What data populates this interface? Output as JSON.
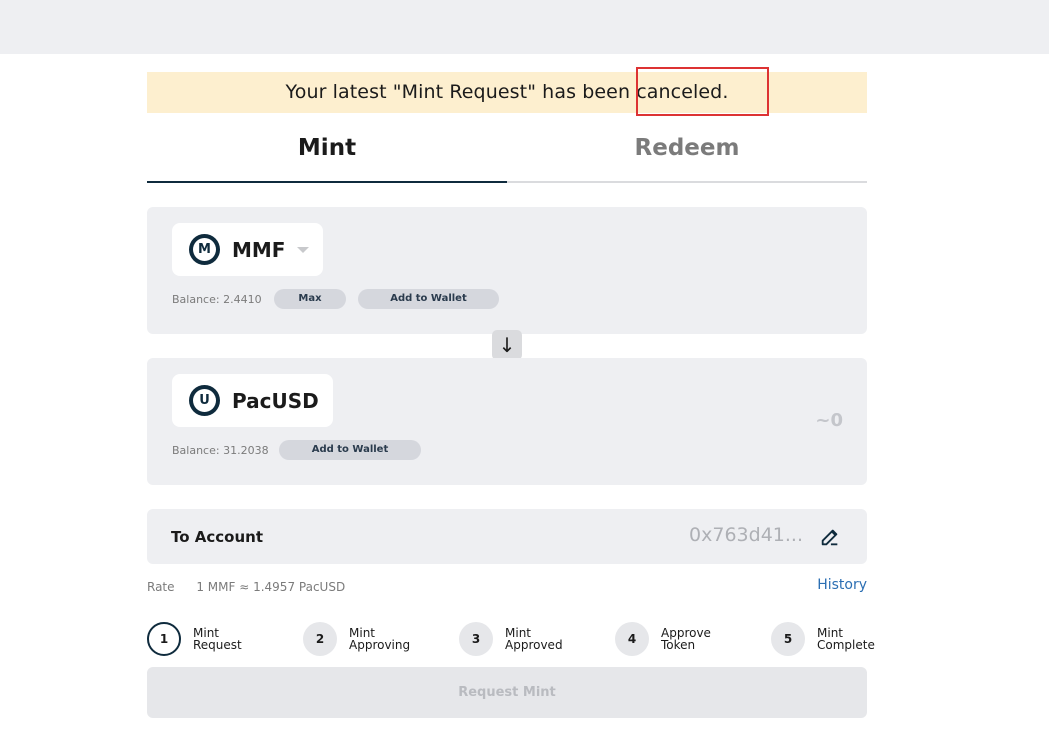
{
  "notice": {
    "text": "Your latest \"Mint Request\" has been canceled."
  },
  "tabs": [
    {
      "label": "Mint",
      "active": true
    },
    {
      "label": "Redeem",
      "active": false
    }
  ],
  "from": {
    "token": "MMF",
    "icon": "mmf-token-icon",
    "balance": "Balance: 2.4410",
    "max_label": "Max",
    "add_wallet_label": "Add to Wallet"
  },
  "swap_arrow": "↓",
  "to": {
    "token": "PacUSD",
    "icon": "pacusd-token-icon",
    "balance": "Balance: 31.2038",
    "add_wallet_label": "Add to Wallet",
    "amount": "~0"
  },
  "account": {
    "label": "To Account",
    "address": "0x763d41...",
    "edit_icon": "pencil-edit-icon"
  },
  "rate": {
    "label": "Rate",
    "value": "1 MMF ≈ 1.4957 PacUSD"
  },
  "history_label": "History",
  "steps": [
    {
      "num": "1",
      "line1": "Mint",
      "line2": "Request",
      "active": true
    },
    {
      "num": "2",
      "line1": "Mint",
      "line2": "Approving",
      "active": false
    },
    {
      "num": "3",
      "line1": "Mint",
      "line2": "Approved",
      "active": false
    },
    {
      "num": "4",
      "line1": "Approve",
      "line2": "Token",
      "active": false
    },
    {
      "num": "5",
      "line1": "Mint",
      "line2": "Complete",
      "active": false
    }
  ],
  "submit_label": "Request Mint",
  "colors": {
    "accent": "#0f2b3d",
    "notice_bg": "#fdefcf",
    "link": "#2c6fb3",
    "highlight": "#dd3333"
  }
}
